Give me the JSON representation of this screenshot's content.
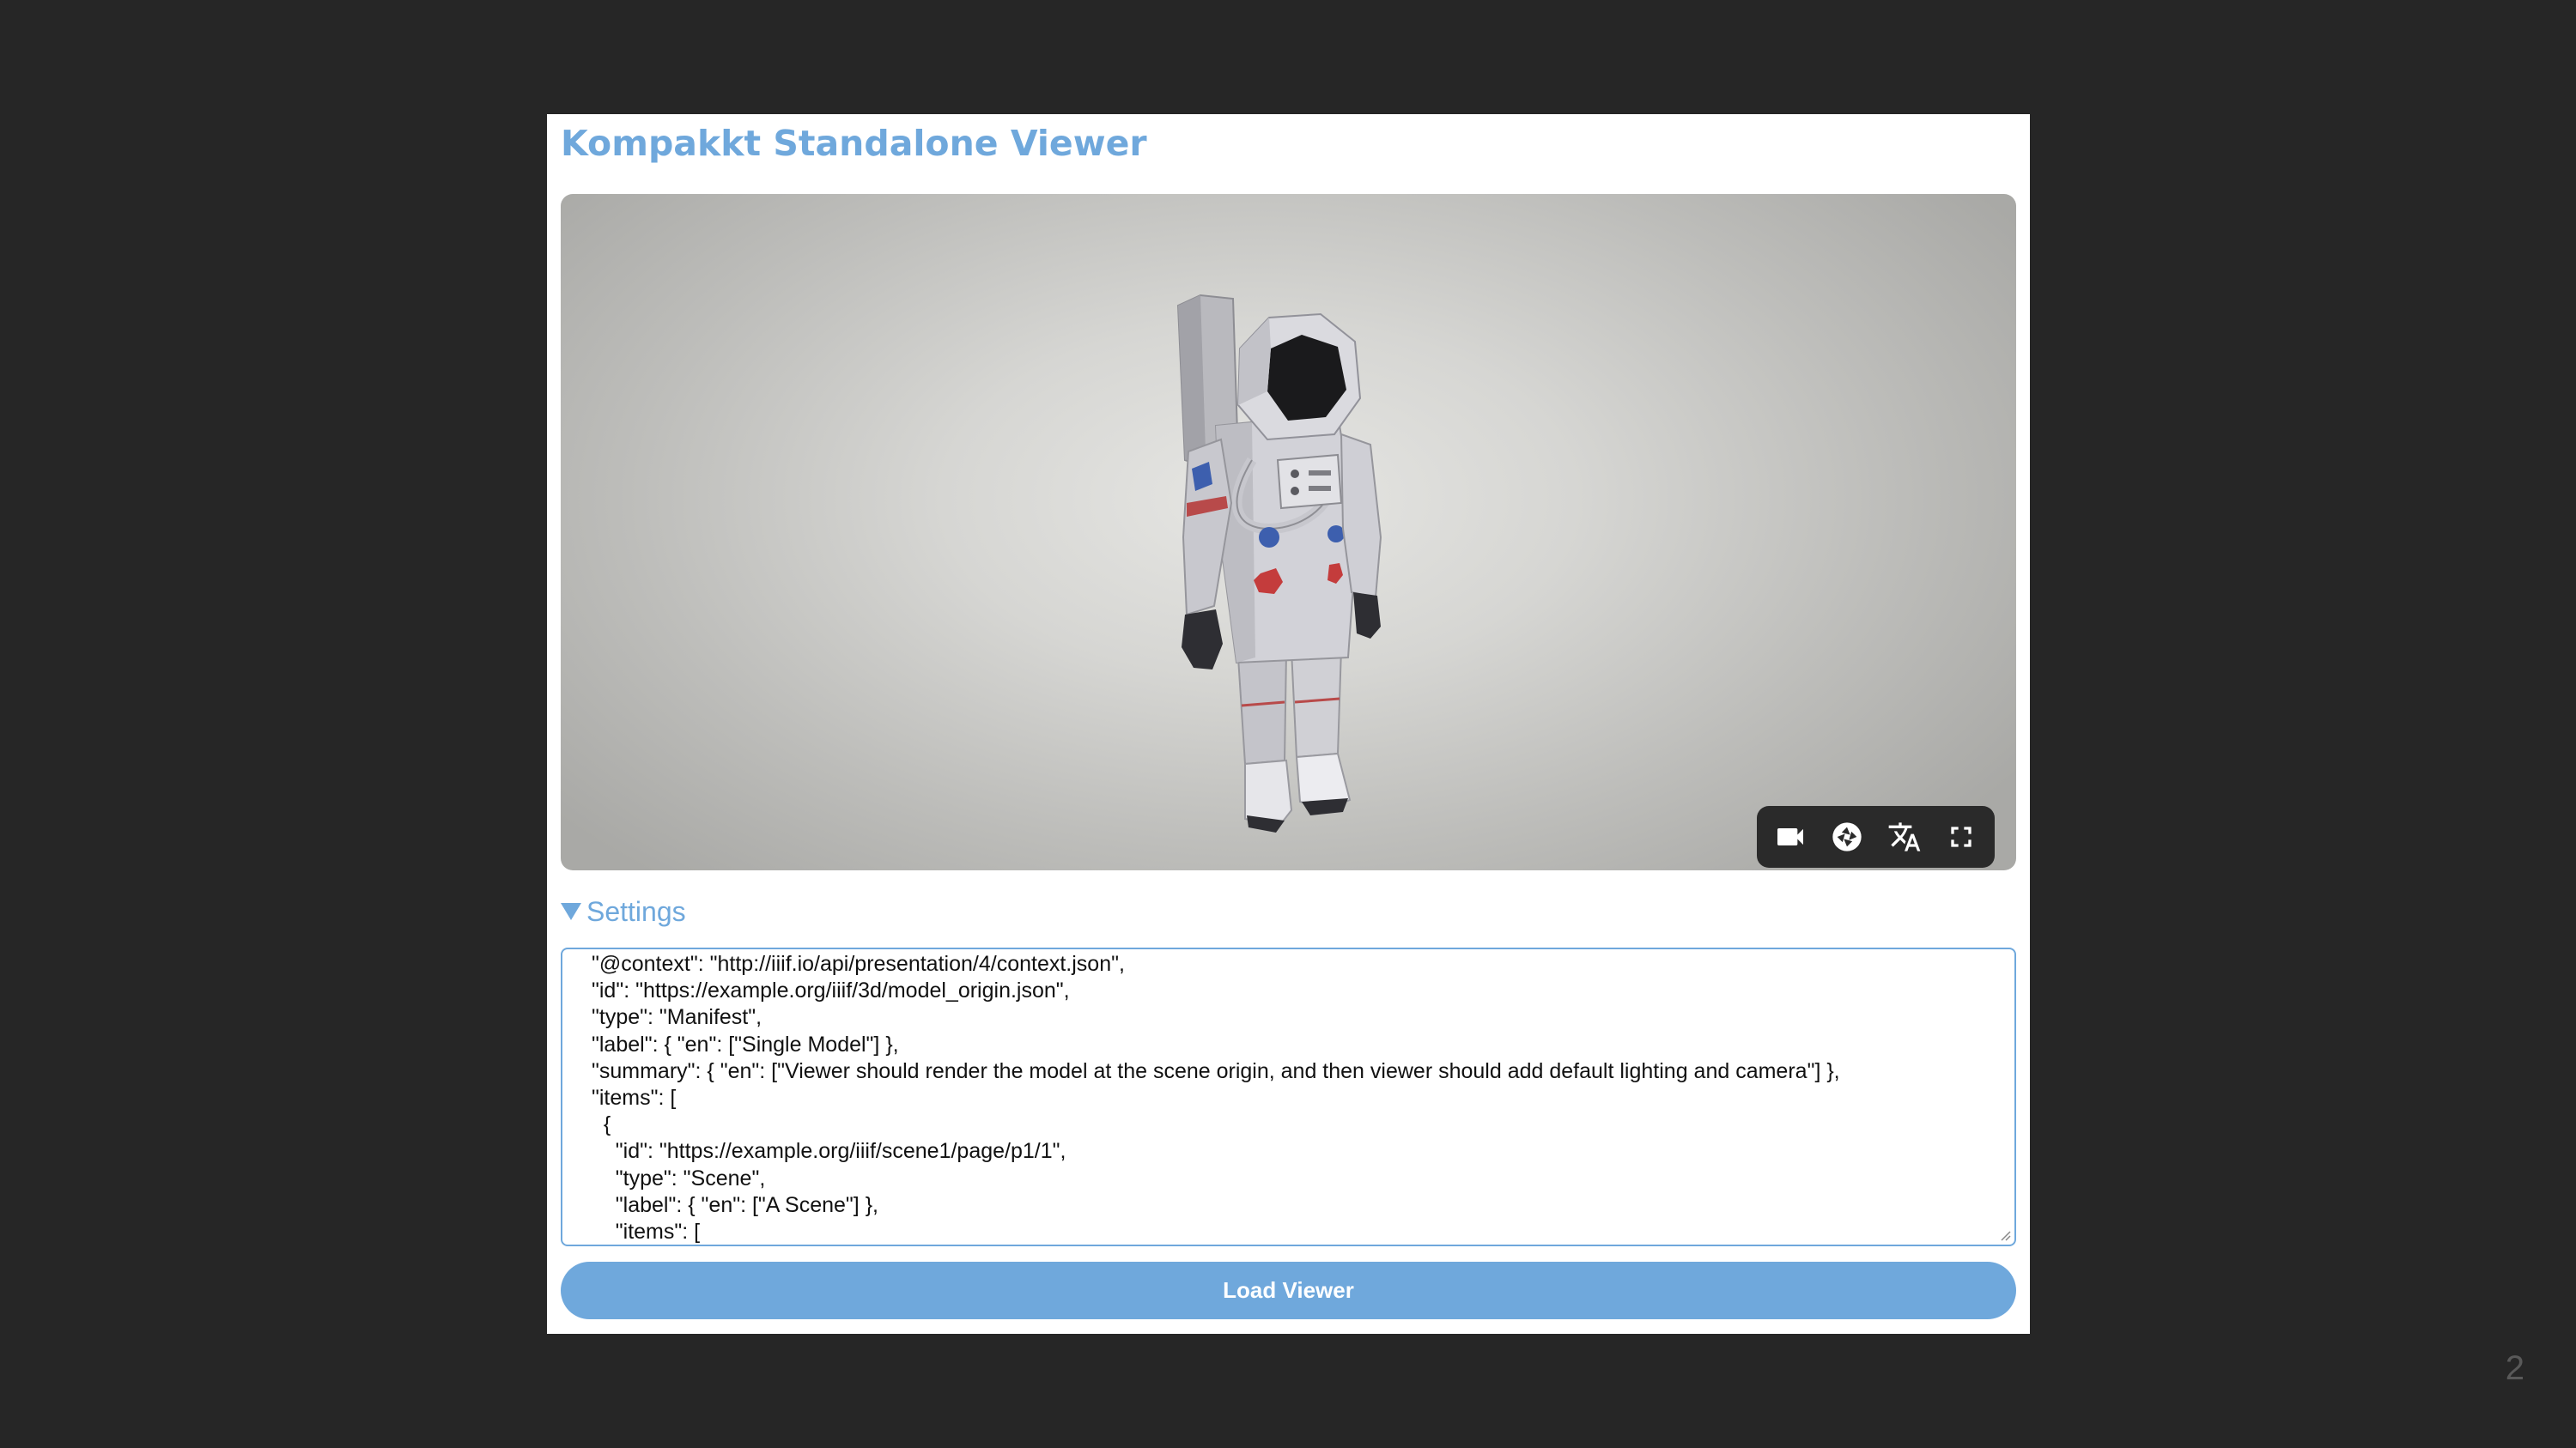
{
  "app": {
    "title": "Kompakkt Standalone Viewer"
  },
  "viewer": {
    "model_description": "astronaut-model",
    "controls": [
      {
        "icon": "video-camera-icon"
      },
      {
        "icon": "camera-shutter-icon"
      },
      {
        "icon": "translate-icon"
      },
      {
        "icon": "fullscreen-icon"
      }
    ],
    "control_bar_color": "#2a2a2a"
  },
  "settings": {
    "label": "Settings",
    "expanded": true
  },
  "manifest_editor": {
    "text": "\"@context\": \"http://iiif.io/api/presentation/4/context.json\",\n\"id\": \"https://example.org/iiif/3d/model_origin.json\",\n\"type\": \"Manifest\",\n\"label\": { \"en\": [\"Single Model\"] },\n\"summary\": { \"en\": [\"Viewer should render the model at the scene origin, and then viewer should add default lighting and camera\"] },\n\"items\": [\n  {\n    \"id\": \"https://example.org/iiif/scene1/page/p1/1\",\n    \"type\": \"Scene\",\n    \"label\": { \"en\": [\"A Scene\"] },\n    \"items\": ["
  },
  "load_button": {
    "label": "Load Viewer"
  },
  "slide": {
    "page_number": "2"
  },
  "colors": {
    "accent": "#6fa8dc",
    "background": "#262626",
    "panel": "#ffffff"
  }
}
